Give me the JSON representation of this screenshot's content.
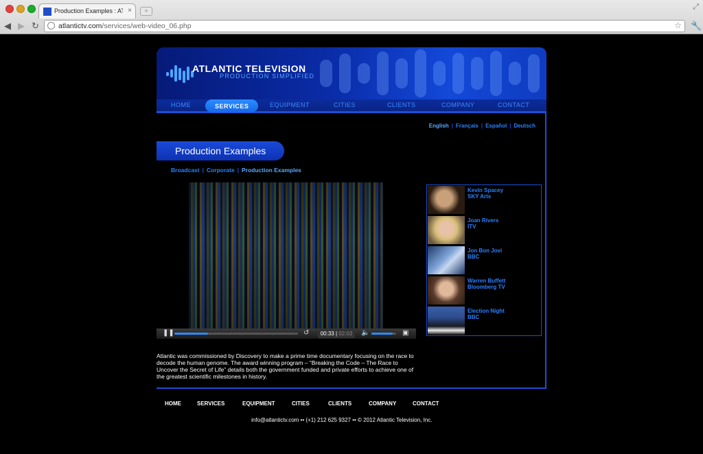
{
  "browser": {
    "tab_title": "Production Examples : ATLA",
    "url_domain": "atlantictv.com",
    "url_path": "/services/web-video_06.php"
  },
  "header": {
    "title": "ATLANTIC TELEVISION",
    "subtitle": "PRODUCTION SIMPLIFIED"
  },
  "nav": {
    "items": [
      "HOME",
      "SERVICES",
      "EQUIPMENT",
      "CITIES",
      "CLIENTS",
      "COMPANY",
      "CONTACT"
    ],
    "active": "SERVICES"
  },
  "languages": [
    "English",
    "Français",
    "Español",
    "Deutsch"
  ],
  "section_title": "Production Examples",
  "subnav": [
    "Broadcast",
    "Corporate",
    "Production Examples"
  ],
  "player": {
    "current_time": "00:33",
    "duration": "02:03",
    "progress": 0.27,
    "volume": 0.85
  },
  "description": "Atlantic was commissioned by Discovery to make a prime time documentary focusing on the race to decode the human genome. The award winning program – “Breaking the Code – The Race to Uncover the Secret of Life” details both the government funded and private efforts to achieve one of the greatest scientific milestones in history.",
  "playlist": [
    {
      "name": "Kevin Spacey",
      "channel": "SKY Arts"
    },
    {
      "name": "Joan Rivers",
      "channel": "ITV"
    },
    {
      "name": "Jon Bon Jovi",
      "channel": "BBC"
    },
    {
      "name": "Warren Buffett",
      "channel": "Bloomberg TV"
    },
    {
      "name": "Election Night",
      "channel": "BBC"
    }
  ],
  "footer": {
    "nav": [
      "HOME",
      "SERVICES",
      "EQUIPMENT",
      "CITIES",
      "CLIENTS",
      "COMPANY",
      "CONTACT"
    ],
    "contact": "info@atlantictv.com  ••  (+1) 212 625 9327  ••  © 2012 Atlantic Television, Inc."
  },
  "colors": {
    "accent": "#2a80ff",
    "header_blue": "#0a2ca8",
    "border_blue": "#1b4fd6"
  }
}
